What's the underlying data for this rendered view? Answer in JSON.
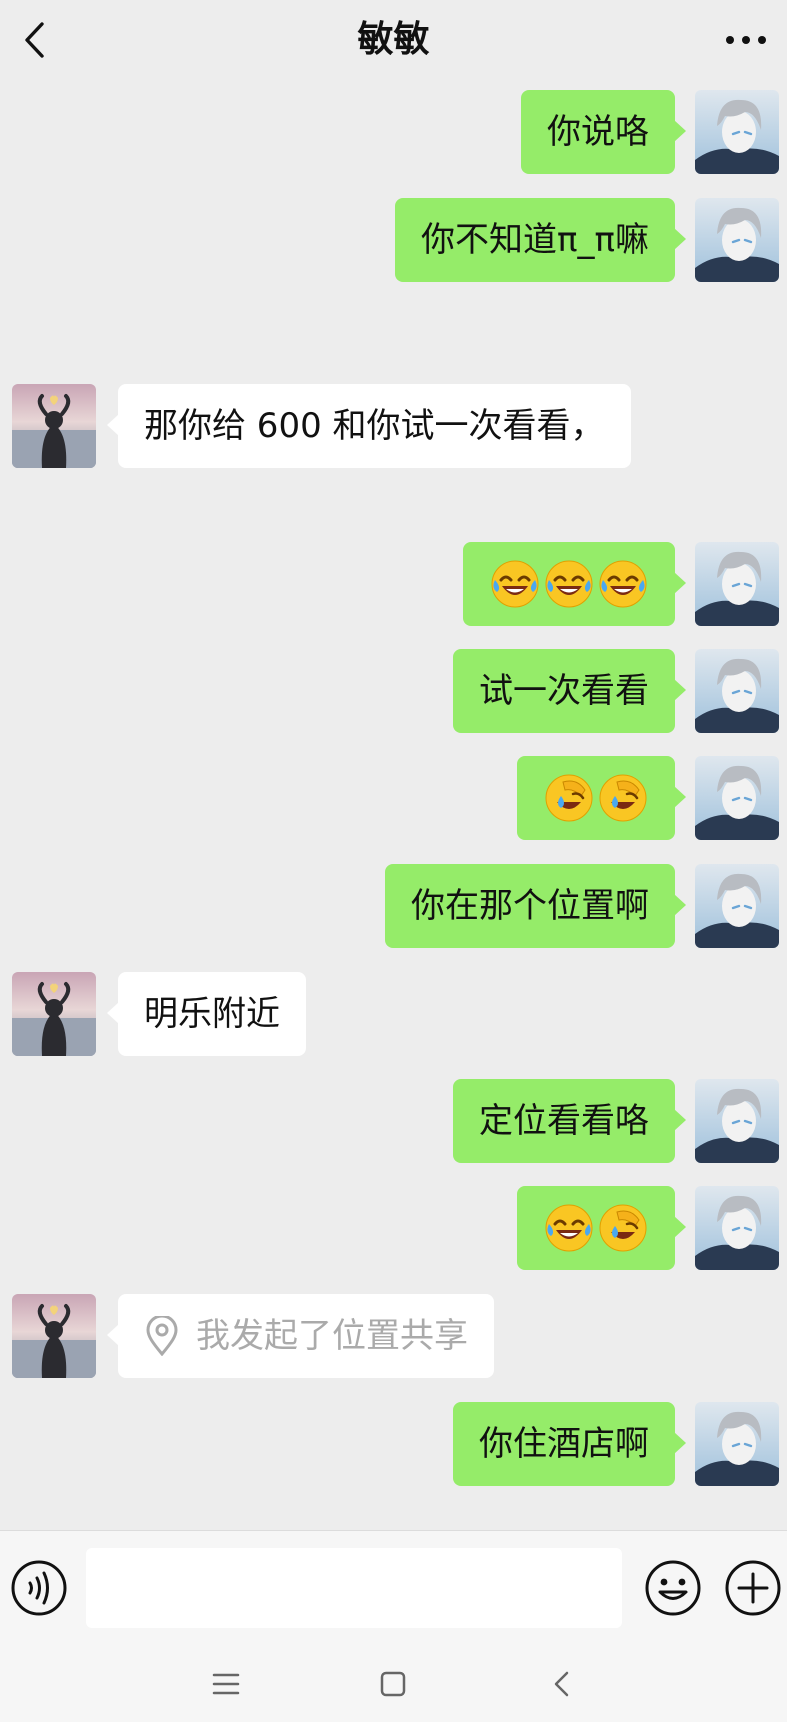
{
  "header": {
    "title": "敏敏"
  },
  "messages": [
    {
      "side": "me",
      "text": "你说咯"
    },
    {
      "side": "me",
      "text": "你不知道π_π嘛"
    },
    {
      "side": "them",
      "text": "那你给 600 和你试一次看看，"
    },
    {
      "side": "me",
      "emojis": [
        "tears-of-joy",
        "tears-of-joy",
        "tears-of-joy"
      ]
    },
    {
      "side": "me",
      "text": "试一次看看"
    },
    {
      "side": "me",
      "emojis": [
        "facepalm",
        "facepalm"
      ]
    },
    {
      "side": "me",
      "text": "你在那个位置啊"
    },
    {
      "side": "them",
      "text": "明乐附近"
    },
    {
      "side": "me",
      "text": "定位看看咯"
    },
    {
      "side": "me",
      "emojis": [
        "tears-of-joy",
        "facepalm"
      ]
    },
    {
      "side": "them",
      "text": "我发起了位置共享",
      "icon": "location-pin-icon"
    },
    {
      "side": "me",
      "text": "你住酒店啊"
    }
  ],
  "input": {
    "value": ""
  },
  "colors": {
    "background": "#ededed",
    "my_bubble": "#95ec69",
    "their_bubble": "#ffffff"
  }
}
